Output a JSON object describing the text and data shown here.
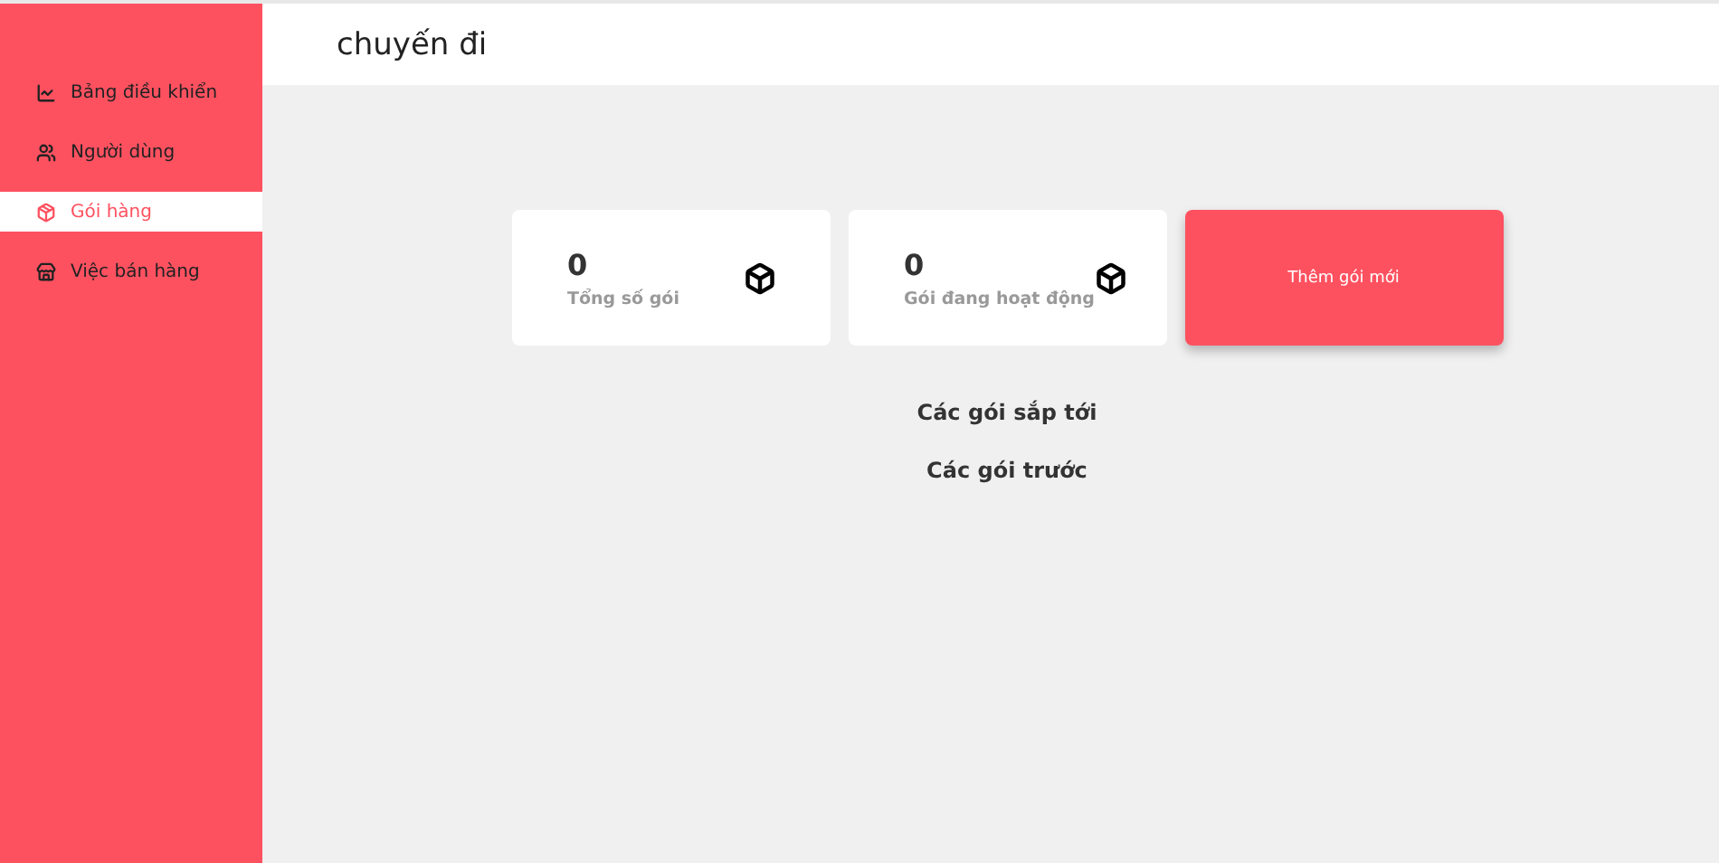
{
  "sidebar": {
    "items": [
      {
        "label": "Bảng điều khiển",
        "kind": "chart",
        "selected": false
      },
      {
        "label": "Người dùng",
        "kind": "users",
        "selected": false
      },
      {
        "label": "Gói hàng",
        "kind": "box",
        "selected": true
      },
      {
        "label": "Việc bán hàng",
        "kind": "store",
        "selected": false
      }
    ]
  },
  "header": {
    "title": "chuyến đi"
  },
  "stats": [
    {
      "value": "0",
      "label": "Tổng số gói"
    },
    {
      "value": "0",
      "label": "Gói đang hoạt động"
    }
  ],
  "add_button": "Thêm gói mới",
  "sections": [
    "Các gói sắp tới",
    "Các gói trước"
  ]
}
